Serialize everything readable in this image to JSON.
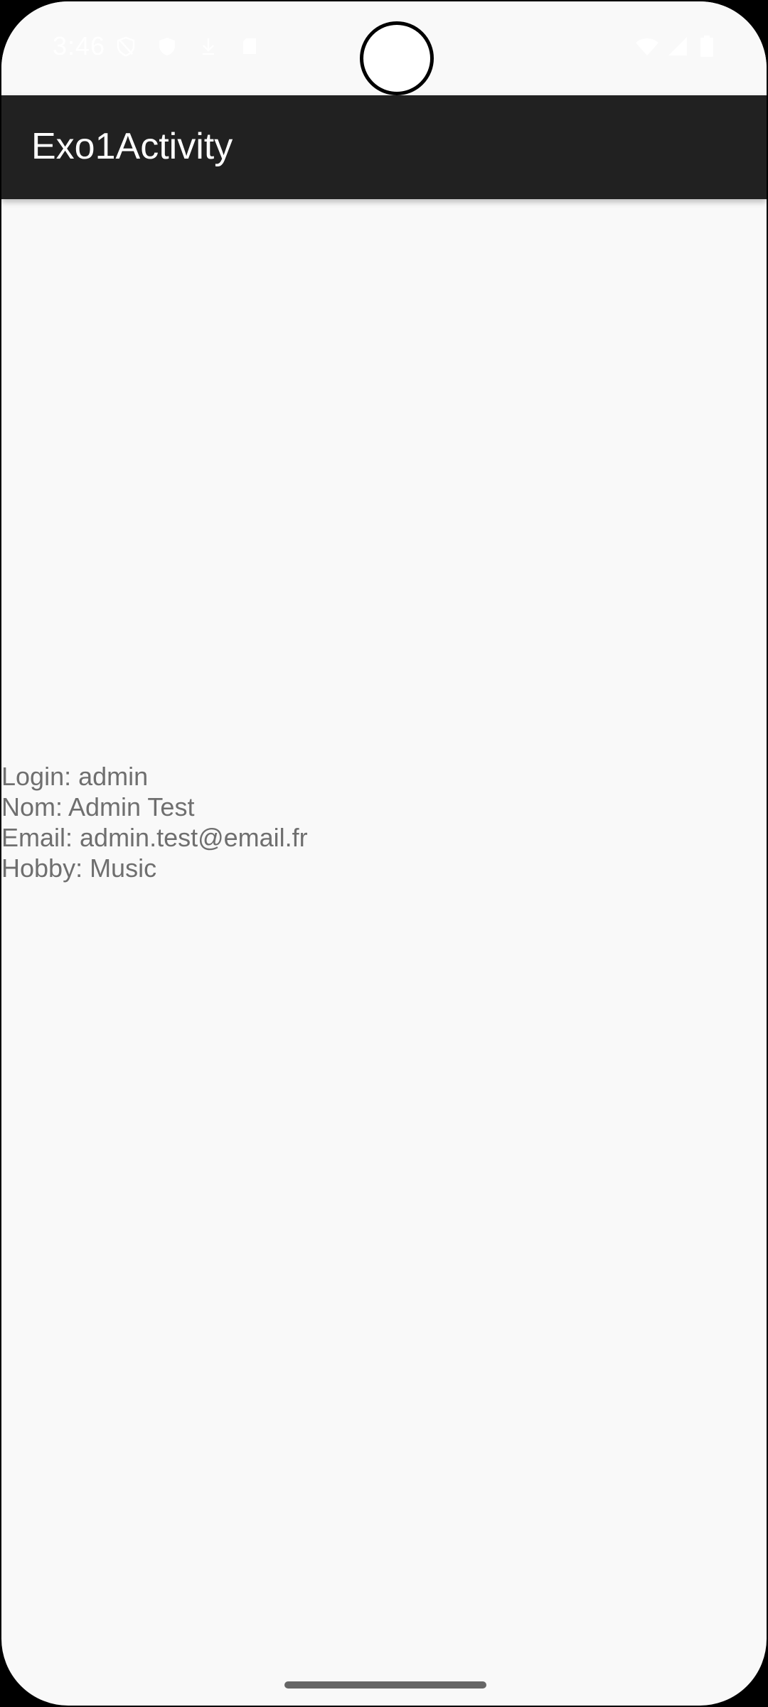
{
  "status_bar": {
    "time": "3:46",
    "icons_left": [
      "vpn-shield-icon",
      "security-shield-icon",
      "download-icon",
      "sd-card-icon"
    ],
    "icons_right": [
      "wifi-icon",
      "cellular-signal-icon",
      "battery-icon"
    ],
    "icon_color": "#ffffff"
  },
  "app_bar": {
    "title": "Exo1Activity",
    "background": "#212121"
  },
  "info": {
    "login": "Login: admin",
    "nom": "Nom: Admin Test",
    "email": "Email: admin.test@email.fr",
    "hobby": "Hobby: Music"
  },
  "colors": {
    "page_background": "#f9f9f9",
    "info_text": "#6f6f6f"
  }
}
